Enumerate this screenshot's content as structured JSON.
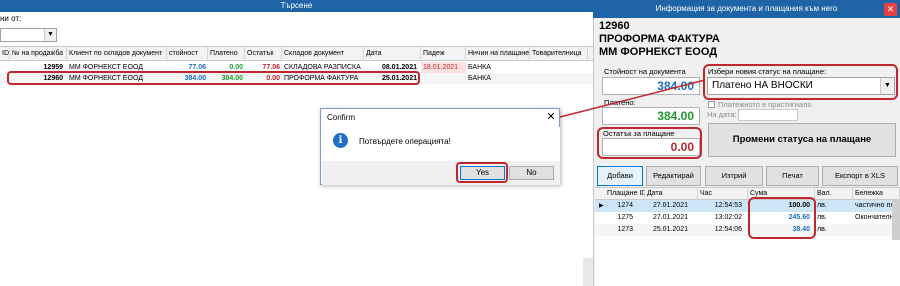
{
  "left": {
    "header": "Търсене",
    "filter_label": "ни от:",
    "columns": [
      "ID",
      "№ на продажба",
      "Клиент по складов документ",
      "стойност",
      "Платено",
      "Остатък",
      "Складов документ",
      "Дата",
      "Падеж",
      "Ннчин на плащане",
      "Товарителница"
    ],
    "rows": [
      {
        "num": "12959",
        "client": "ММ ФОРНЕКСТ ЕООД",
        "value": "77.06",
        "paid": "0.00",
        "rest": "77.06",
        "doc": "СКЛАДОВА РАЗПИСКА",
        "date": "08.01.2021",
        "due": "18.01.2021",
        "pay": "БАНКА"
      },
      {
        "num": "12960",
        "client": "ММ ФОРНЕКСТ ЕООД",
        "value": "384.00",
        "paid": "384.00",
        "rest": "0.00",
        "doc": "ПРОФОРМА ФАКТУРА",
        "date": "25.01.2021",
        "due": "",
        "pay": "БАНКА"
      }
    ]
  },
  "dialog": {
    "title": "Confirm",
    "close": "✕",
    "message": "Потвърдете операцията!",
    "yes": "Yes",
    "no": "No"
  },
  "right": {
    "header": "Информация за документа и плащания към него",
    "close": "✕",
    "doc_number": "12960",
    "doc_type": "ПРОФОРМА ФАКТУРА",
    "client": "ММ ФОРНЕКСТ ЕООД",
    "value_label": "Стойност на документа",
    "value": "384.00",
    "paid_label": "Платено:",
    "paid": "384.00",
    "balance_label": "Остатък за плащане",
    "balance": "0.00",
    "status_label": "Избери новия статус на плащане:",
    "status_value": "Платено НА ВНОСКИ",
    "paid_check_label": "Платежното е пристигнало",
    "date_label": "На дата:",
    "change_button": "Промени статуса на плащане",
    "tabs": [
      "Добави",
      "Редактирай",
      "Изтрий",
      "Печат",
      "Експорт в XLS"
    ],
    "pay_columns": [
      "Плащане ID",
      "Дата",
      "Час",
      "Сума",
      "Вал.",
      "Бележка"
    ],
    "payments": [
      {
        "id": "1274",
        "date": "27.01.2021",
        "time": "12:54:53",
        "sum": "100.00",
        "cur": "лв.",
        "note": "частично пла"
      },
      {
        "id": "1275",
        "date": "27.01.2021",
        "time": "13:02:02",
        "sum": "245.60",
        "cur": "лв.",
        "note": "Окончателно"
      },
      {
        "id": "1273",
        "date": "25.01.2021",
        "time": "12:54:06",
        "sum": "38.40",
        "cur": "лв.",
        "note": ""
      }
    ]
  },
  "colors": {
    "header_blue": "#1f64a6",
    "value_blue": "#1a6fbf",
    "paid_green": "#1e9a2c",
    "rest_red": "#c0272d",
    "highlight_red": "#c0272d"
  }
}
